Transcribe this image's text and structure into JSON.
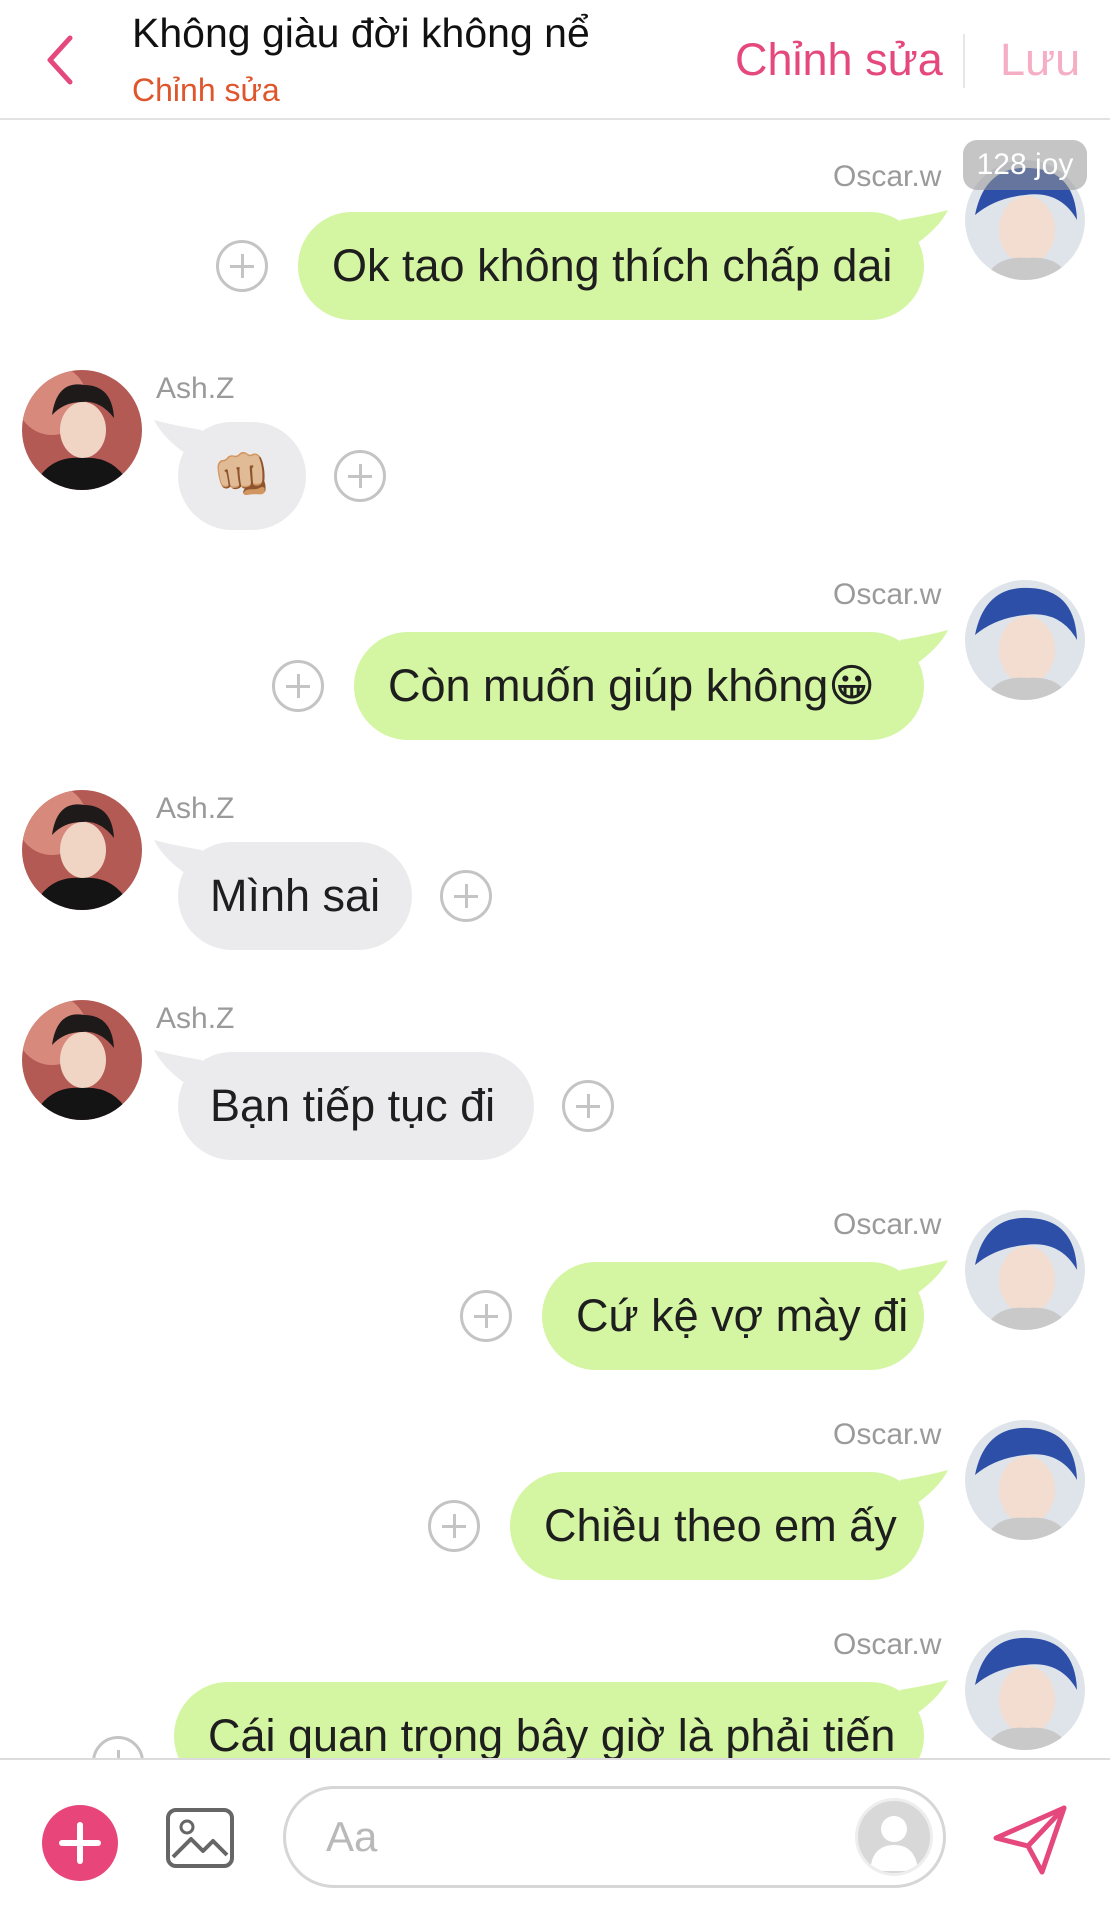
{
  "header": {
    "title": "Không giàu đời không nể",
    "subtitle": "Chỉnh sửa",
    "edit_label": "Chỉnh sửa",
    "save_label": "Lưu"
  },
  "badge": "128 joy",
  "messages": [
    {
      "sender": "Oscar.w",
      "direction": "outgoing",
      "text": "Ok tao không thích chấp dai"
    },
    {
      "sender": "Ash.Z",
      "direction": "incoming",
      "text": "👊🏼"
    },
    {
      "sender": "Oscar.w",
      "direction": "outgoing",
      "text": "Còn muốn giúp không😀"
    },
    {
      "sender": "Ash.Z",
      "direction": "incoming",
      "text": "Mình sai"
    },
    {
      "sender": "Ash.Z",
      "direction": "incoming",
      "text": "Bạn tiếp tục đi"
    },
    {
      "sender": "Oscar.w",
      "direction": "outgoing",
      "text": "Cứ kệ vợ mày đi"
    },
    {
      "sender": "Oscar.w",
      "direction": "outgoing",
      "text": "Chiều theo em ấy"
    },
    {
      "sender": "Oscar.w",
      "direction": "outgoing",
      "text": "Cái quan trọng bây giờ là phải tiến"
    }
  ],
  "composer": {
    "placeholder": "Aa"
  },
  "colors": {
    "accent": "#e5487c",
    "outgoing_bubble": "#d4f5a1",
    "incoming_bubble": "#ebebed",
    "subtitle": "#e0562c"
  },
  "icons": [
    "chevron-left-icon",
    "plus-circle-icon",
    "add-icon",
    "image-icon",
    "avatar-placeholder-icon",
    "send-icon"
  ]
}
